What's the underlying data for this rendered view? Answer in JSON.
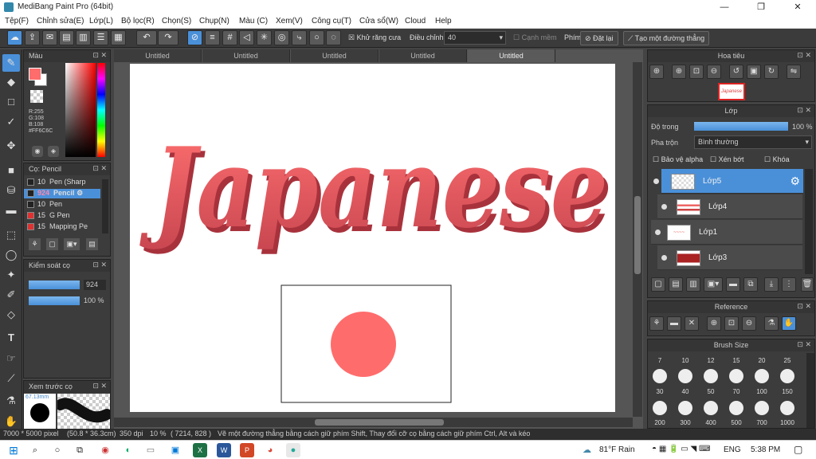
{
  "window": {
    "title": "MediBang Paint Pro (64bit)",
    "minimize": "—",
    "maximize": "❐",
    "close": "✕"
  },
  "menu": [
    "Tệp(F)",
    "Chỉnh sửa(E)",
    "Lớp(L)",
    "Bộ lọc(R)",
    "Chọn(S)",
    "Chụp(N)",
    "Màu (C)",
    "Xem(V)",
    "Công cụ(T)",
    "Cửa sổ(W)",
    "Cloud",
    "Help"
  ],
  "toolbar": {
    "antialias": "Khử răng cưa",
    "adjust_label": "Điều chỉnh",
    "adjust_value": "40",
    "smooth": "Cạnh mềm",
    "key_label": "Phím",
    "reset": "Đặt lại",
    "create_line": "Tạo một đường thẳng"
  },
  "tabs": [
    "Untitled",
    "Untitled",
    "Untitled",
    "Untitled",
    "Untitled"
  ],
  "color_panel": {
    "title": "Màu",
    "r": "R:255",
    "g": "G:108",
    "b": "B:108",
    "hex": "#FF6C6C",
    "primary": "#ff6c6c"
  },
  "brush_panel": {
    "title": "Cọ: Pencil",
    "items": [
      {
        "size": "10",
        "name": "Pen (Sharp",
        "color": "#222222"
      },
      {
        "size": "924",
        "name": "Pencil",
        "color": "#222222"
      },
      {
        "size": "10",
        "name": "Pen",
        "color": "#222222"
      },
      {
        "size": "15",
        "name": "G Pen",
        "color": "#e03030"
      },
      {
        "size": "15",
        "name": "Mapping Pe",
        "color": "#e03030"
      }
    ]
  },
  "brush_control": {
    "title": "Kiểm soát cọ",
    "size": "924",
    "opacity": "100 %"
  },
  "preview": {
    "title": "Xem trước cọ",
    "size": "67.13mm"
  },
  "canvas": {
    "text": "Japanese"
  },
  "navigator": {
    "title": "Hoa tiêu"
  },
  "layers": {
    "title": "Lớp",
    "opacity_label": "Độ trong",
    "opacity_value": "100 %",
    "blend_label": "Pha trộn",
    "blend_value": "Bình thường",
    "protect_alpha": "Bảo vệ alpha",
    "clip": "Xén bớt",
    "lock": "Khóa",
    "items": [
      "Lớp5",
      "Lớp4",
      "Lớp1",
      "Lớp3"
    ]
  },
  "reference": {
    "title": "Reference"
  },
  "brush_size": {
    "title": "Brush Size",
    "top_labels": [
      "7",
      "10",
      "12",
      "15",
      "20",
      "25"
    ],
    "row1": [
      "30",
      "40",
      "50",
      "70",
      "100",
      "150"
    ],
    "row2": [
      "200",
      "300",
      "400",
      "500",
      "700",
      "1000"
    ]
  },
  "status": {
    "size": "7000 * 5000 pixel",
    "mm": "(50.8 * 36.3cm)",
    "dpi": "350 dpi",
    "zoom": "10 %",
    "coords": "( 7214, 828 )",
    "hint": "Vẽ một đường thẳng bằng cách giữ phím Shift, Thay đổi cỡ cọ bằng cách giữ phím Ctrl, Alt và kéo"
  },
  "taskbar": {
    "weather": "81°F  Rain",
    "lang": "ENG",
    "time": "5:38 PM"
  }
}
